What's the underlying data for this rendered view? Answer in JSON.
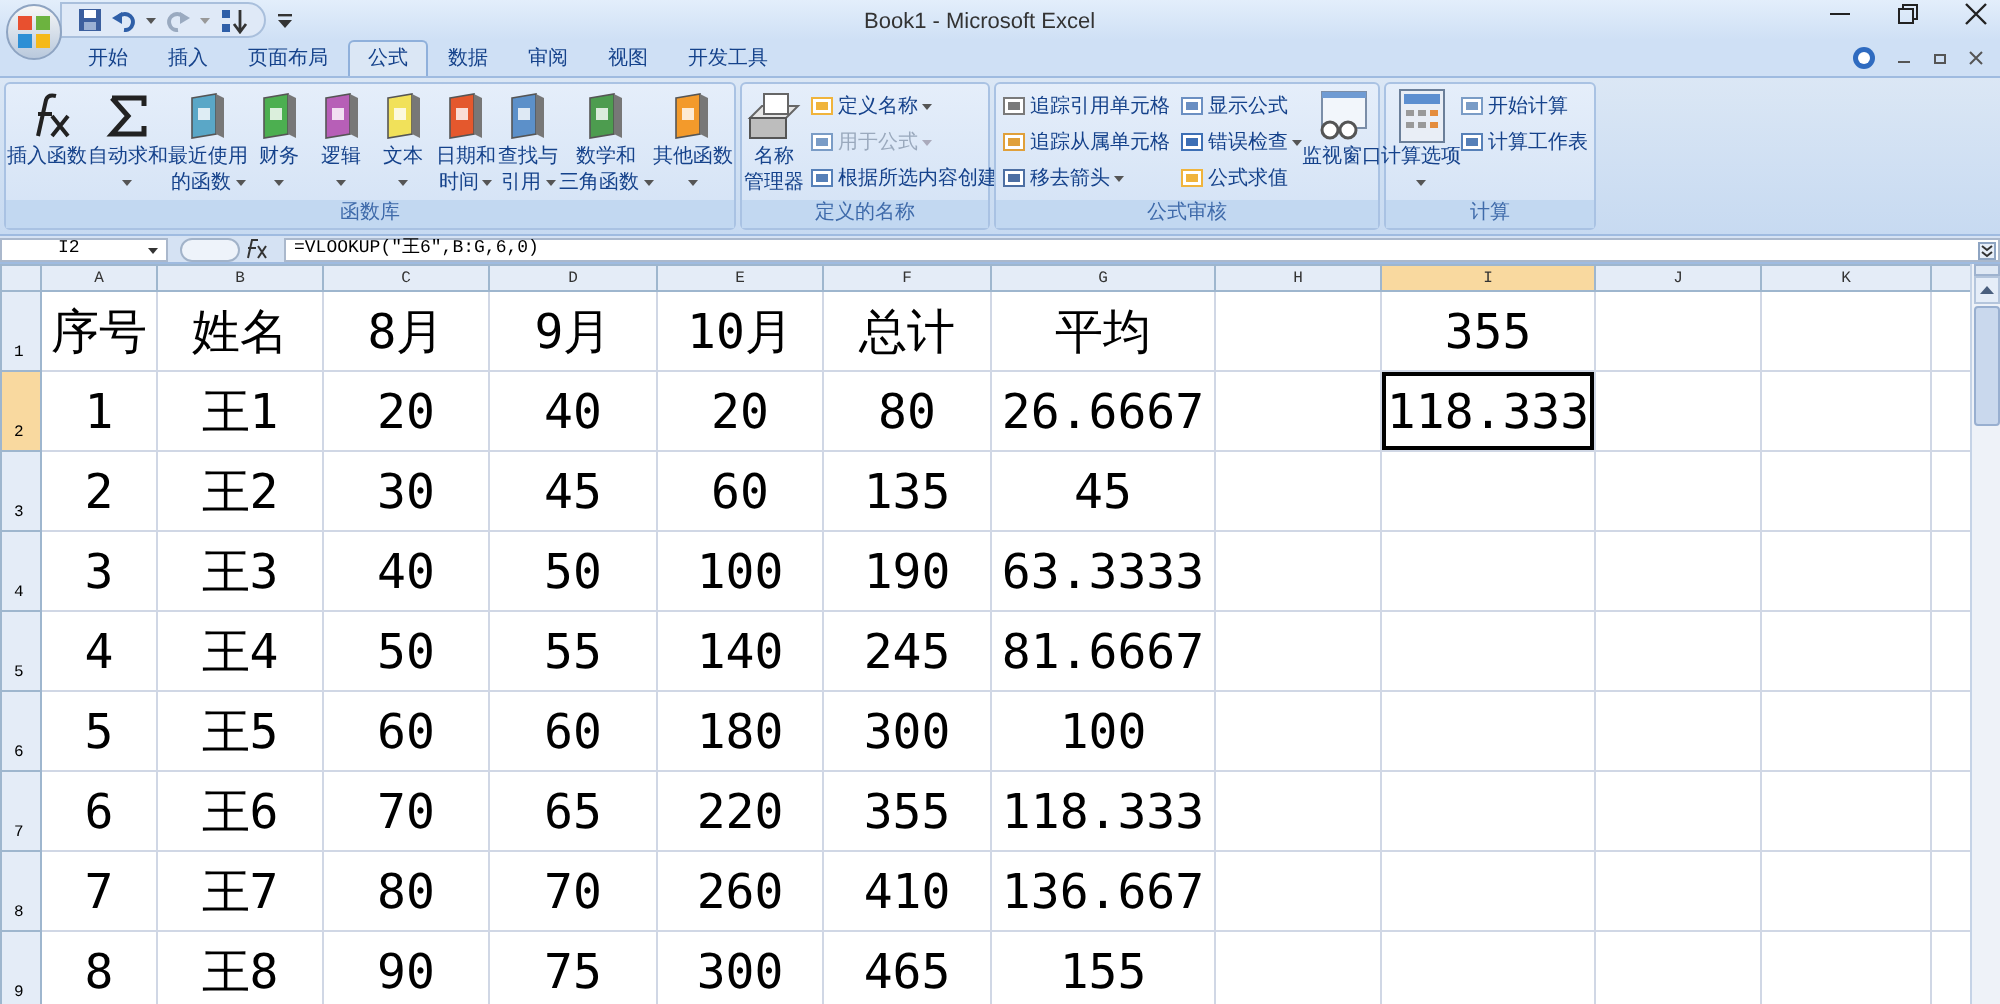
{
  "window": {
    "title": "Book1 - Microsoft Excel"
  },
  "tabs": [
    {
      "label": "开始",
      "selected": false
    },
    {
      "label": "插入",
      "selected": false
    },
    {
      "label": "页面布局",
      "selected": false
    },
    {
      "label": "公式",
      "selected": true
    },
    {
      "label": "数据",
      "selected": false
    },
    {
      "label": "审阅",
      "selected": false
    },
    {
      "label": "视图",
      "selected": false
    },
    {
      "label": "开发工具",
      "selected": false
    }
  ],
  "ribbon": {
    "groups": [
      {
        "title": "函数库",
        "items": [
          {
            "kind": "large",
            "lines": [
              "插入函数"
            ],
            "dropdown": false
          },
          {
            "kind": "large",
            "lines": [
              "自动求和"
            ],
            "dropdown": true
          },
          {
            "kind": "large",
            "lines": [
              "最近使用",
              "的函数"
            ],
            "dropdown": true
          },
          {
            "kind": "large",
            "lines": [
              "财务"
            ],
            "dropdown": true
          },
          {
            "kind": "large",
            "lines": [
              "逻辑"
            ],
            "dropdown": true
          },
          {
            "kind": "large",
            "lines": [
              "文本"
            ],
            "dropdown": true
          },
          {
            "kind": "large",
            "lines": [
              "日期和",
              "时间"
            ],
            "dropdown": true
          },
          {
            "kind": "large",
            "lines": [
              "查找与",
              "引用"
            ],
            "dropdown": true
          },
          {
            "kind": "large",
            "lines": [
              "数学和",
              "三角函数"
            ],
            "dropdown": true
          },
          {
            "kind": "large",
            "lines": [
              "其他函数"
            ],
            "dropdown": true
          }
        ]
      },
      {
        "title": "定义的名称",
        "items": [
          {
            "kind": "large",
            "lines": [
              "名称",
              "管理器"
            ],
            "dropdown": false
          },
          {
            "kind": "small_column",
            "buttons": [
              {
                "label": "定义名称",
                "dropdown": true,
                "disabled": false
              },
              {
                "label": "用于公式",
                "dropdown": true,
                "disabled": true
              },
              {
                "label": "根据所选内容创建",
                "dropdown": false,
                "disabled": false
              }
            ]
          }
        ]
      },
      {
        "title": "公式审核",
        "items": [
          {
            "kind": "small_column",
            "buttons": [
              {
                "label": "追踪引用单元格",
                "dropdown": false,
                "disabled": false
              },
              {
                "label": "追踪从属单元格",
                "dropdown": false,
                "disabled": false
              },
              {
                "label": "移去箭头",
                "dropdown": true,
                "disabled": false
              }
            ]
          },
          {
            "kind": "small_column",
            "buttons": [
              {
                "label": "显示公式",
                "dropdown": false,
                "disabled": false
              },
              {
                "label": "错误检查",
                "dropdown": true,
                "disabled": false
              },
              {
                "label": "公式求值",
                "dropdown": false,
                "disabled": false
              }
            ]
          },
          {
            "kind": "large",
            "lines": [
              "监视窗口"
            ],
            "dropdown": false
          }
        ]
      },
      {
        "title": "计算",
        "items": [
          {
            "kind": "large",
            "lines": [
              "计算选项"
            ],
            "dropdown": true
          },
          {
            "kind": "small_column",
            "buttons": [
              {
                "label": "开始计算",
                "dropdown": false,
                "disabled": false
              },
              {
                "label": "计算工作表",
                "dropdown": false,
                "disabled": false
              }
            ]
          }
        ]
      }
    ]
  },
  "formula_bar": {
    "name_box": "I2",
    "formula": "=VLOOKUP(\"王6\",B:G,6,0)"
  },
  "sheet": {
    "columns": [
      {
        "label": "A",
        "selected": false
      },
      {
        "label": "B",
        "selected": false
      },
      {
        "label": "C",
        "selected": false
      },
      {
        "label": "D",
        "selected": false
      },
      {
        "label": "E",
        "selected": false
      },
      {
        "label": "F",
        "selected": false
      },
      {
        "label": "G",
        "selected": false
      },
      {
        "label": "H",
        "selected": false
      },
      {
        "label": "I",
        "selected": true
      },
      {
        "label": "J",
        "selected": false
      },
      {
        "label": "K",
        "selected": false
      }
    ],
    "rows": [
      {
        "label": "1",
        "selected": false,
        "cells": [
          {
            "text": "序号",
            "selected": false
          },
          {
            "text": "姓名",
            "selected": false
          },
          {
            "text": "8月",
            "selected": false
          },
          {
            "text": "9月",
            "selected": false
          },
          {
            "text": "10月",
            "selected": false
          },
          {
            "text": "总计",
            "selected": false
          },
          {
            "text": "平均",
            "selected": false
          },
          null,
          {
            "text": "355",
            "selected": false
          }
        ]
      },
      {
        "label": "2",
        "selected": true,
        "cells": [
          {
            "text": "1",
            "selected": false
          },
          {
            "text": "王1",
            "selected": false
          },
          {
            "text": "20",
            "selected": false
          },
          {
            "text": "40",
            "selected": false
          },
          {
            "text": "20",
            "selected": false
          },
          {
            "text": "80",
            "selected": false
          },
          {
            "text": "26.6667",
            "selected": false
          },
          null,
          {
            "text": "118.333",
            "selected": true
          }
        ]
      },
      {
        "label": "3",
        "selected": false,
        "cells": [
          {
            "text": "2",
            "selected": false
          },
          {
            "text": "王2",
            "selected": false
          },
          {
            "text": "30",
            "selected": false
          },
          {
            "text": "45",
            "selected": false
          },
          {
            "text": "60",
            "selected": false
          },
          {
            "text": "135",
            "selected": false
          },
          {
            "text": "45",
            "selected": false
          }
        ]
      },
      {
        "label": "4",
        "selected": false,
        "cells": [
          {
            "text": "3",
            "selected": false
          },
          {
            "text": "王3",
            "selected": false
          },
          {
            "text": "40",
            "selected": false
          },
          {
            "text": "50",
            "selected": false
          },
          {
            "text": "100",
            "selected": false
          },
          {
            "text": "190",
            "selected": false
          },
          {
            "text": "63.3333",
            "selected": false
          }
        ]
      },
      {
        "label": "5",
        "selected": false,
        "cells": [
          {
            "text": "4",
            "selected": false
          },
          {
            "text": "王4",
            "selected": false
          },
          {
            "text": "50",
            "selected": false
          },
          {
            "text": "55",
            "selected": false
          },
          {
            "text": "140",
            "selected": false
          },
          {
            "text": "245",
            "selected": false
          },
          {
            "text": "81.6667",
            "selected": false
          }
        ]
      },
      {
        "label": "6",
        "selected": false,
        "cells": [
          {
            "text": "5",
            "selected": false
          },
          {
            "text": "王5",
            "selected": false
          },
          {
            "text": "60",
            "selected": false
          },
          {
            "text": "60",
            "selected": false
          },
          {
            "text": "180",
            "selected": false
          },
          {
            "text": "300",
            "selected": false
          },
          {
            "text": "100",
            "selected": false
          }
        ]
      },
      {
        "label": "7",
        "selected": false,
        "cells": [
          {
            "text": "6",
            "selected": false
          },
          {
            "text": "王6",
            "selected": false
          },
          {
            "text": "70",
            "selected": false
          },
          {
            "text": "65",
            "selected": false
          },
          {
            "text": "220",
            "selected": false
          },
          {
            "text": "355",
            "selected": false
          },
          {
            "text": "118.333",
            "selected": false
          }
        ]
      },
      {
        "label": "8",
        "selected": false,
        "cells": [
          {
            "text": "7",
            "selected": false
          },
          {
            "text": "王7",
            "selected": false
          },
          {
            "text": "80",
            "selected": false
          },
          {
            "text": "70",
            "selected": false
          },
          {
            "text": "260",
            "selected": false
          },
          {
            "text": "410",
            "selected": false
          },
          {
            "text": "136.667",
            "selected": false
          }
        ]
      },
      {
        "label": "9",
        "selected": false,
        "cells": [
          {
            "text": "8",
            "selected": false
          },
          {
            "text": "王8",
            "selected": false
          },
          {
            "text": "90",
            "selected": false
          },
          {
            "text": "75",
            "selected": false
          },
          {
            "text": "300",
            "selected": false
          },
          {
            "text": "465",
            "selected": false
          },
          {
            "text": "155",
            "selected": false
          }
        ]
      }
    ]
  }
}
